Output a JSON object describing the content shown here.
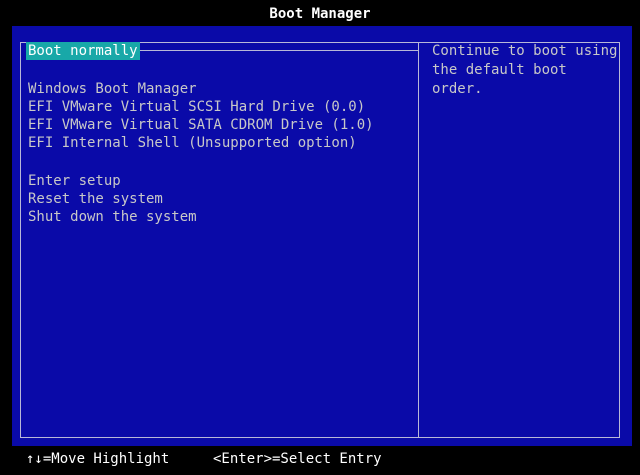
{
  "window": {
    "title": "Boot Manager"
  },
  "menu": {
    "groups": [
      {
        "items": [
          {
            "label": "Boot normally",
            "selected": true
          }
        ]
      },
      {
        "items": [
          {
            "label": "Windows Boot Manager",
            "selected": false
          },
          {
            "label": "EFI VMware Virtual SCSI Hard Drive (0.0)",
            "selected": false
          },
          {
            "label": "EFI VMware Virtual SATA CDROM Drive (1.0)",
            "selected": false
          },
          {
            "label": "EFI Internal Shell (Unsupported option)",
            "selected": false
          }
        ]
      },
      {
        "items": [
          {
            "label": "Enter setup",
            "selected": false
          },
          {
            "label": "Reset the system",
            "selected": false
          },
          {
            "label": "Shut down the system",
            "selected": false
          }
        ]
      }
    ]
  },
  "help": {
    "text": "Continue to boot using the default boot order."
  },
  "footer": {
    "move_hint": "↑↓=Move Highlight",
    "select_hint": "<Enter>=Select Entry"
  },
  "colors": {
    "background": "#0a0aa8",
    "highlight": "#18a8a8",
    "text": "#c8c8c8",
    "title": "#ffffff",
    "border": "#b8b8d8"
  }
}
